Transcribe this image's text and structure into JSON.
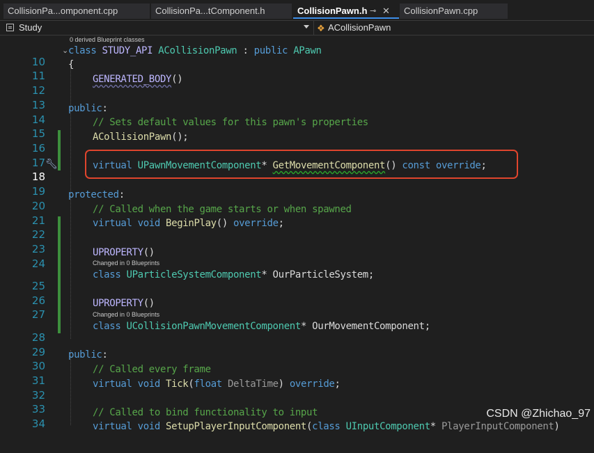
{
  "tabs": [
    {
      "label": "CollisionPa...omponent.cpp",
      "active": false
    },
    {
      "label": "CollisionPa...tComponent.h",
      "active": false
    },
    {
      "label": "CollisionPawn.h",
      "active": true,
      "pin": "⊸",
      "close": "✕"
    },
    {
      "label": "CollisionPawn.cpp",
      "active": false
    }
  ],
  "navbar": {
    "project": "Study",
    "scope_icon": "class-icon",
    "scope": "ACollisionPawn"
  },
  "codelens": {
    "derived": "0 derived Blueprint classes",
    "changed_1": "Changed in 0 Blueprints",
    "changed_2": "Changed in 0 Blueprints"
  },
  "line_numbers": [
    "10",
    "11",
    "12",
    "13",
    "14",
    "15",
    "16",
    "17",
    "18",
    "19",
    "20",
    "21",
    "22",
    "23",
    "24",
    "25",
    "26",
    "27",
    "28",
    "29",
    "30",
    "31",
    "32",
    "33",
    "34"
  ],
  "current_line": "18",
  "code": {
    "l10": {
      "kw_class": "class ",
      "api": "STUDY_API ",
      "cls": "ACollisionPawn",
      "colon": " : ",
      "kw_public": "public ",
      "base": "APawn"
    },
    "l11": "{",
    "l12": {
      "mac": "GENERATED_BODY",
      "paren": "()"
    },
    "l14": {
      "kw": "public",
      "colon": ":"
    },
    "l15": "// Sets default values for this pawn's properties",
    "l16": {
      "fn": "ACollisionPawn",
      "rest": "();"
    },
    "l18": {
      "kw_virtual": "virtual ",
      "type": "UPawnMovementComponent",
      "star": "* ",
      "fn": "GetMovementComponent",
      "paren": "() ",
      "kw_const": "const ",
      "kw_override": "override",
      "semi": ";"
    },
    "l20": {
      "kw": "protected",
      "colon": ":"
    },
    "l21": "// Called when the game starts or when spawned",
    "l22": {
      "kw_virtual": "virtual ",
      "kw_void": "void ",
      "fn": "BeginPlay",
      "paren": "() ",
      "kw_override": "override",
      "semi": ";"
    },
    "l24": {
      "mac": "UPROPERTY",
      "paren": "()"
    },
    "l25": {
      "kw_class": "class ",
      "type": "UParticleSystemComponent",
      "star": "* ",
      "id": "OurParticleSystem",
      "semi": ";"
    },
    "l27": {
      "mac": "UPROPERTY",
      "paren": "()"
    },
    "l28": {
      "kw_class": "class ",
      "type": "UCollisionPawnMovementComponent",
      "star": "* ",
      "id": "OurMovementComponent",
      "semi": ";"
    },
    "l30": {
      "kw": "public",
      "colon": ":"
    },
    "l31": "// Called every frame",
    "l32": {
      "kw_virtual": "virtual ",
      "kw_void": "void ",
      "fn": "Tick",
      "open": "(",
      "kw_float": "float ",
      "param": "DeltaTime",
      "close": ") ",
      "kw_override": "override",
      "semi": ";"
    },
    "l34": "// Called to bind functionality to input",
    "l35": {
      "kw_virtual": "virtual ",
      "kw_void": "void ",
      "fn": "SetupPlayerInputComponent",
      "open": "(",
      "kw_class": "class ",
      "type": "UInputComponent",
      "star": "* ",
      "param": "PlayerInputComponent",
      "close": ")"
    }
  },
  "watermark": "CSDN @Zhichao_97",
  "colors": {
    "keyword": "#569cd6",
    "type": "#4ec9b0",
    "function": "#dcdcaa",
    "macro": "#beb7ff",
    "comment": "#57a64a",
    "line_number": "#2b91af",
    "highlight_box": "#e0452d",
    "change_bar": "#3d8f3d"
  }
}
